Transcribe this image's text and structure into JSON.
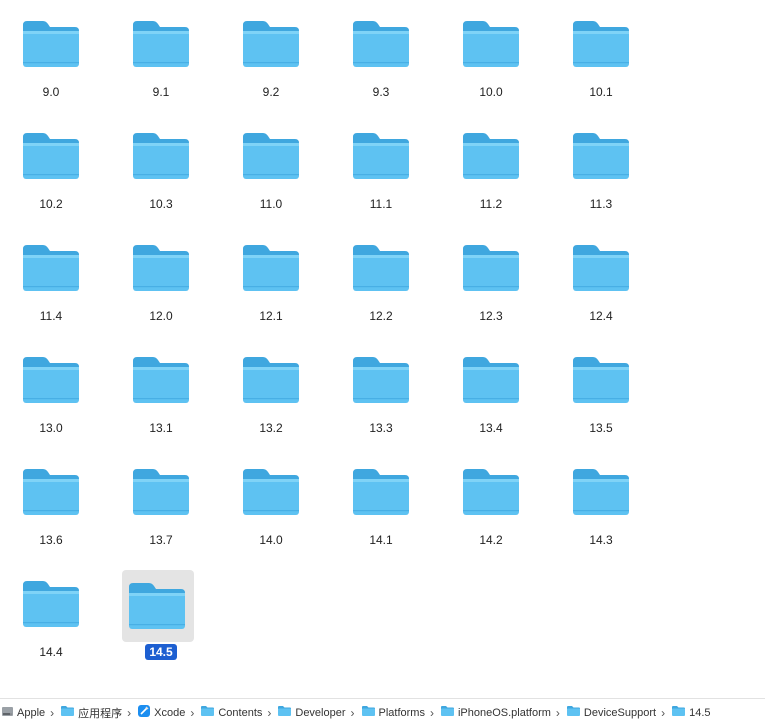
{
  "folders": [
    "9.0",
    "9.1",
    "9.2",
    "9.3",
    "10.0",
    "10.1",
    "10.2",
    "10.3",
    "11.0",
    "11.1",
    "11.2",
    "11.3",
    "11.4",
    "12.0",
    "12.1",
    "12.2",
    "12.3",
    "12.4",
    "13.0",
    "13.1",
    "13.2",
    "13.3",
    "13.4",
    "13.5",
    "13.6",
    "13.7",
    "14.0",
    "14.1",
    "14.2",
    "14.3",
    "14.4",
    "14.5"
  ],
  "selected_folder": "14.5",
  "pathbar": {
    "separator": "›",
    "items": [
      {
        "label": "Apple",
        "icon": "hard-drive-icon"
      },
      {
        "label": "应用程序",
        "icon": "folder-icon"
      },
      {
        "label": "Xcode",
        "icon": "xcode-app-icon"
      },
      {
        "label": "Contents",
        "icon": "folder-icon"
      },
      {
        "label": "Developer",
        "icon": "folder-icon"
      },
      {
        "label": "Platforms",
        "icon": "folder-icon"
      },
      {
        "label": "iPhoneOS.platform",
        "icon": "folder-icon"
      },
      {
        "label": "DeviceSupport",
        "icon": "folder-icon"
      },
      {
        "label": "14.5",
        "icon": "folder-icon"
      }
    ]
  },
  "colors": {
    "folder_body": "#5ec2f2",
    "folder_tab": "#3fa7df",
    "selection": "#1d5fd1",
    "selection_bg": "#e4e4e4"
  }
}
